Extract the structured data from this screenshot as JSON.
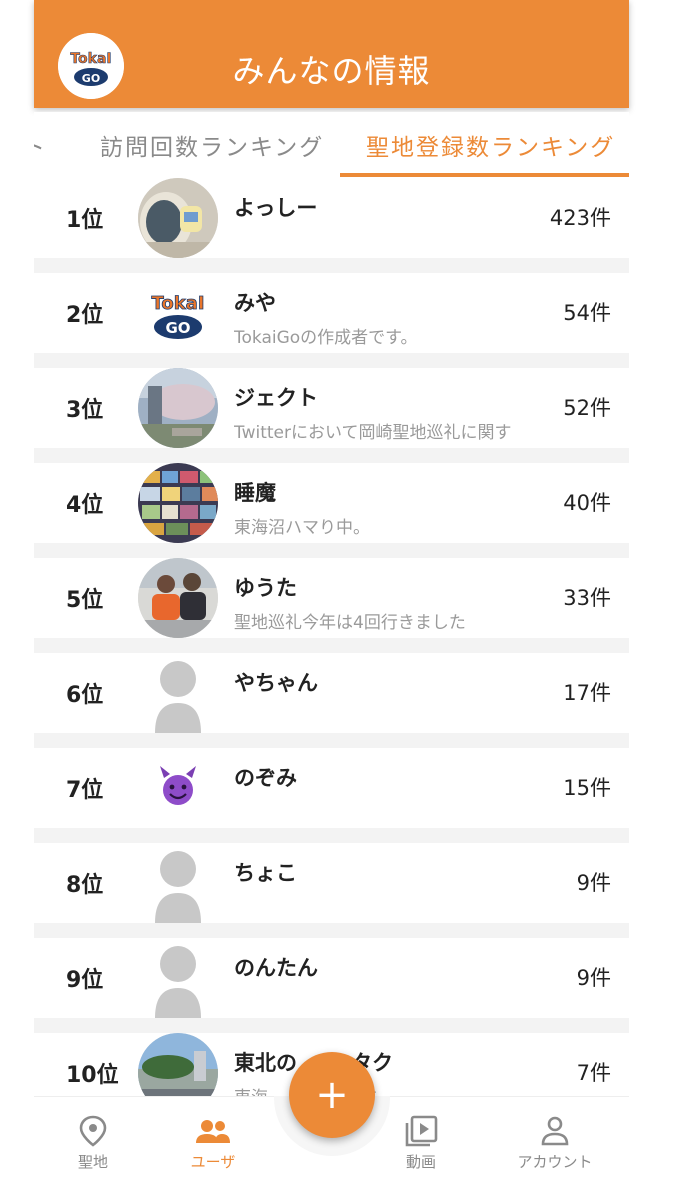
{
  "header": {
    "title": "みんなの情報",
    "logo_text_top": "TokaI",
    "logo_text_bottom": "GO"
  },
  "tabs": [
    {
      "label": "ト"
    },
    {
      "label": "訪問回数ランキング"
    },
    {
      "label": "聖地登録数ランキング",
      "active": true
    }
  ],
  "ranking": [
    {
      "rank": "1位",
      "name": "よっしー",
      "bio": "",
      "count": "423件",
      "avatar": "photo-mug-icon"
    },
    {
      "rank": "2位",
      "name": "みや",
      "bio": "TokaiGoの作成者です。",
      "count": "54件",
      "avatar": "tokaigo-logo-icon"
    },
    {
      "rank": "3位",
      "name": "ジェクト",
      "bio": "Twitterにおいて岡崎聖地巡礼に関す",
      "count": "52件",
      "avatar": "photo-cherry-blossom-icon"
    },
    {
      "rank": "4位",
      "name": "睡魔",
      "bio": "東海沼ハマり中。",
      "count": "40件",
      "avatar": "photo-collage-icon"
    },
    {
      "rank": "5位",
      "name": "ゆうた",
      "bio": "聖地巡礼今年は4回行きました",
      "count": "33件",
      "avatar": "photo-people-icon"
    },
    {
      "rank": "6位",
      "name": "やちゃん",
      "bio": "",
      "count": "17件",
      "avatar": "default-user-icon"
    },
    {
      "rank": "7位",
      "name": "のぞみ",
      "bio": "",
      "count": "15件",
      "avatar": "smiling-devil-icon"
    },
    {
      "rank": "8位",
      "name": "ちょこ",
      "bio": "",
      "count": "9件",
      "avatar": "default-user-icon"
    },
    {
      "rank": "9位",
      "name": "のんたん",
      "bio": "",
      "count": "9件",
      "avatar": "default-user-icon"
    },
    {
      "rank": "10位",
      "name": "東北の",
      "name_tail": "タク",
      "bio": "東海",
      "bio_tail": "す",
      "count": "7件",
      "avatar": "photo-street-icon"
    }
  ],
  "bottom_nav": [
    {
      "label": "聖地",
      "icon": "map-pin-icon"
    },
    {
      "label": "ユーザ",
      "icon": "users-icon",
      "active": true
    },
    {
      "label": "動画",
      "icon": "video-library-icon"
    },
    {
      "label": "アカウント",
      "icon": "person-icon"
    }
  ],
  "fab": {
    "label": "+",
    "icon": "plus-icon"
  },
  "colors": {
    "accent": "#ec8a37",
    "separator": "#f3f3f3",
    "muted": "#9a9a9a"
  }
}
